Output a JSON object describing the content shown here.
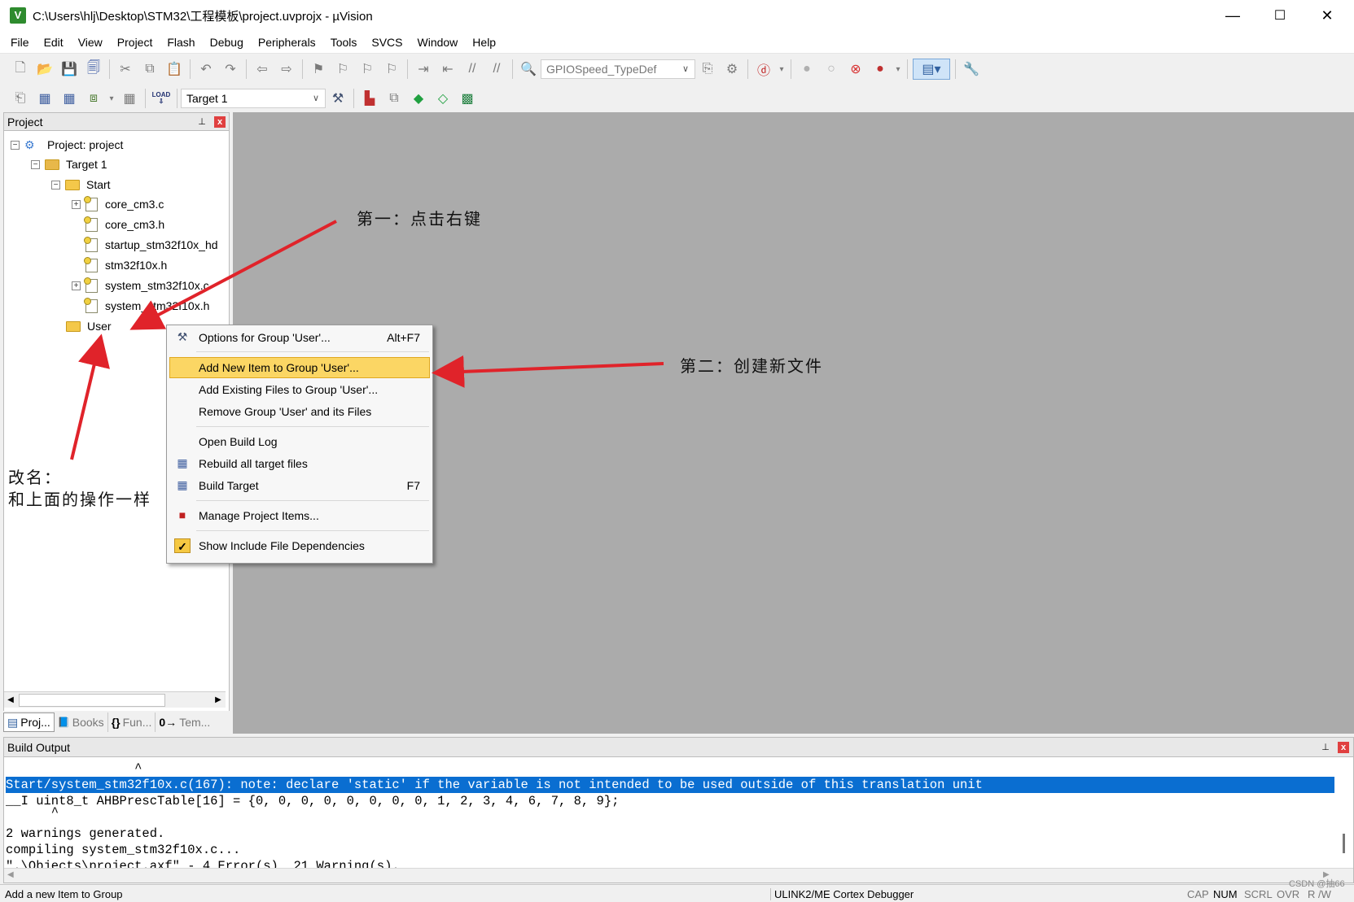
{
  "window": {
    "title": "C:\\Users\\hlj\\Desktop\\STM32\\工程模板\\project.uvprojx - µVision",
    "app_icon": "V",
    "controls": {
      "minimize": "—",
      "maximize": "☐",
      "close": "✕"
    }
  },
  "menubar": [
    "File",
    "Edit",
    "View",
    "Project",
    "Flash",
    "Debug",
    "Peripherals",
    "Tools",
    "SVCS",
    "Window",
    "Help"
  ],
  "toolbar1": {
    "find_combo": "GPIOSpeed_TypeDef"
  },
  "toolbar2": {
    "target_combo": "Target 1",
    "load_label": "LOAD"
  },
  "project_panel": {
    "title": "Project",
    "pin_icon": "⊥",
    "close_icon": "x",
    "tree": {
      "root": "Project: project",
      "target": "Target 1",
      "group_start": "Start",
      "files": [
        "core_cm3.c",
        "core_cm3.h",
        "startup_stm32f10x_hd",
        "stm32f10x.h",
        "system_stm32f10x.c",
        "system_stm32f10x.h"
      ],
      "group_user": "User"
    },
    "tabs": [
      {
        "icon": "▤",
        "label": "Proj..."
      },
      {
        "icon": "📘",
        "label": "Books"
      },
      {
        "icon": "{}",
        "label": "Fun..."
      },
      {
        "icon": "0→",
        "label": "Tem..."
      }
    ]
  },
  "context_menu": {
    "items": [
      {
        "icon": "⚒",
        "label": "Options for Group 'User'...",
        "shortcut": "Alt+F7"
      },
      {
        "icon": "",
        "label": "Add New  Item to Group 'User'...",
        "shortcut": ""
      },
      {
        "icon": "",
        "label": "Add Existing Files to Group 'User'...",
        "shortcut": ""
      },
      {
        "icon": "",
        "label": "Remove Group 'User' and its Files",
        "shortcut": ""
      },
      {
        "icon": "",
        "label": "Open Build Log",
        "shortcut": ""
      },
      {
        "icon": "▦",
        "label": "Rebuild all target files",
        "shortcut": ""
      },
      {
        "icon": "▦",
        "label": "Build Target",
        "shortcut": "F7"
      },
      {
        "icon": "■",
        "label": "Manage Project Items...",
        "shortcut": ""
      },
      {
        "icon": "✓",
        "label": "Show Include File Dependencies",
        "shortcut": ""
      }
    ]
  },
  "annotations": {
    "step1": "第一：点击右键",
    "step2": "第二：创建新文件",
    "rename_line1": "改名：",
    "rename_line2": "和上面的操作一样"
  },
  "build_output": {
    "title": "Build Output",
    "lines": [
      "                 ^",
      "Start/system_stm32f10x.c(167): note: declare 'static' if the variable is not intended to be used outside of this translation unit",
      "__I uint8_t AHBPrescTable[16] = {0, 0, 0, 0, 0, 0, 0, 0, 1, 2, 3, 4, 6, 7, 8, 9};",
      "      ^",
      "2 warnings generated.",
      "compiling system_stm32f10x.c...",
      "\".\\Objects\\project.axf\" - 4 Error(s), 21 Warning(s)."
    ]
  },
  "statusbar": {
    "message": "Add a new Item to Group",
    "debugger": "ULINK2/ME Cortex Debugger",
    "indicators": [
      "CAP",
      "NUM",
      "SCRL",
      "OVR",
      "R /W"
    ],
    "watermark": "CSDN @抽66"
  },
  "colors": {
    "arrow": "#e0232a",
    "highlight": "#0a6ed1",
    "menu_hover": "#fbd664",
    "editor_bg": "#ababab"
  }
}
